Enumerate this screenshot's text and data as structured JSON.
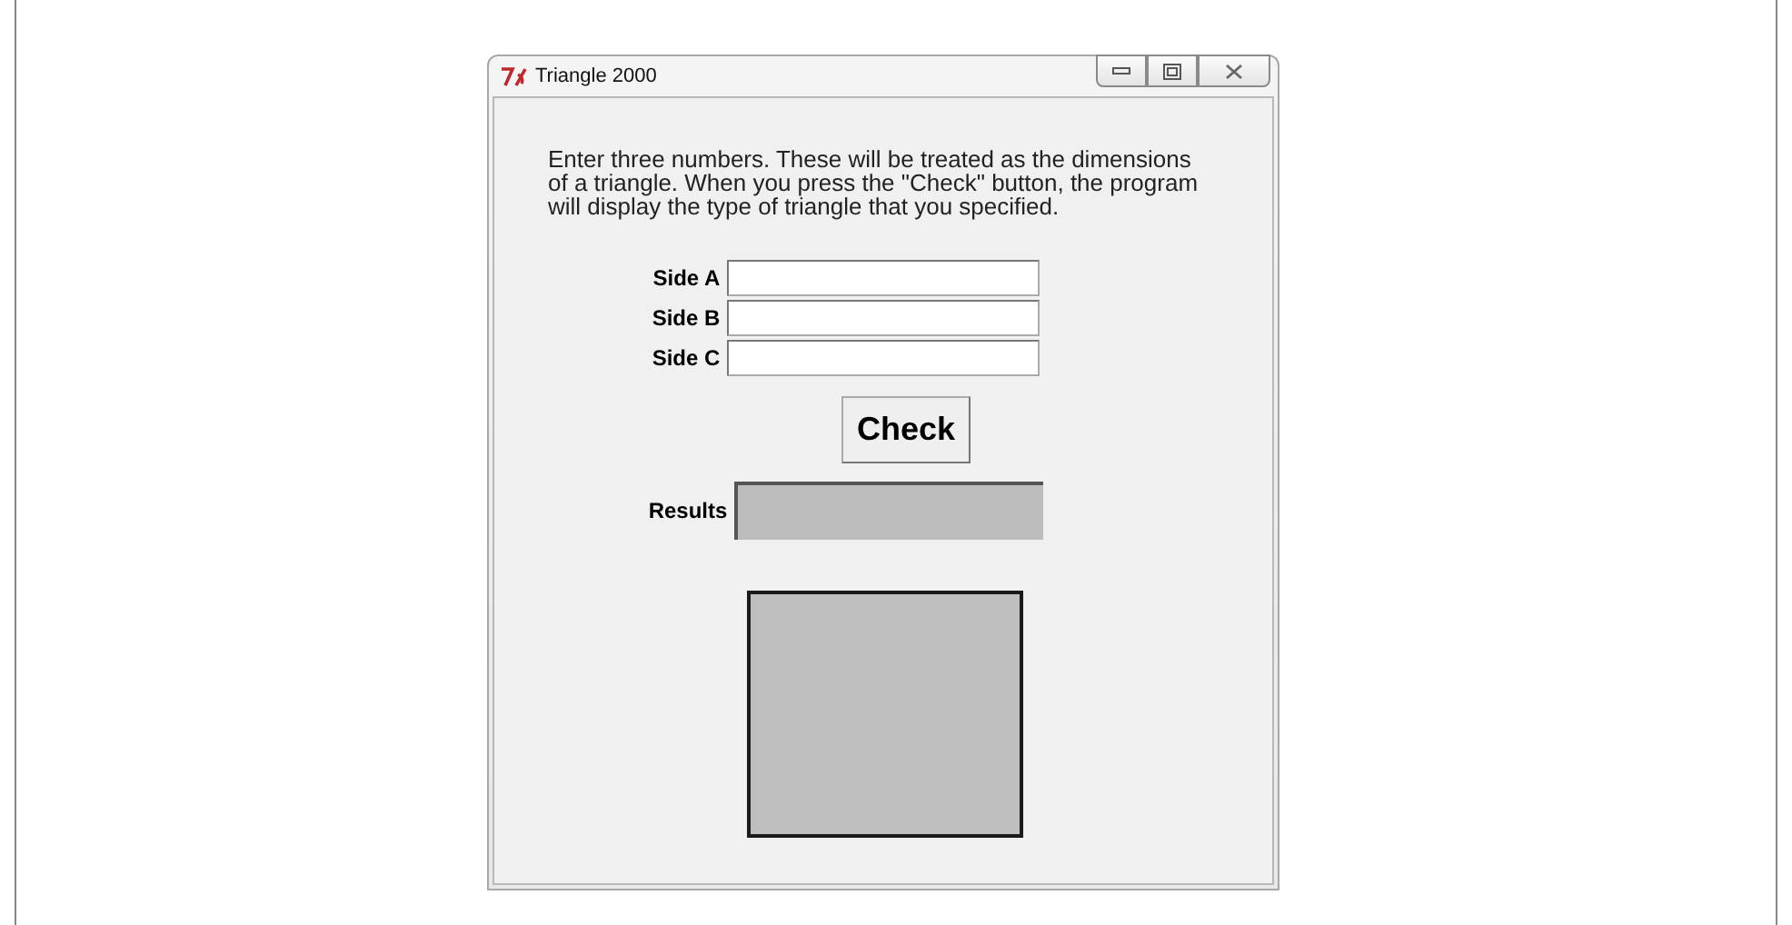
{
  "window": {
    "title": "Triangle 2000"
  },
  "description": "Enter three numbers. These will be treated as the dimensions of a triangle. When you press the \"Check\" button, the program will display the type of triangle that you specified.",
  "fields": [
    {
      "label": "Side A"
    },
    {
      "label": "Side B"
    },
    {
      "label": "Side C"
    }
  ],
  "check_button": "Check",
  "results": {
    "label": "Results"
  }
}
